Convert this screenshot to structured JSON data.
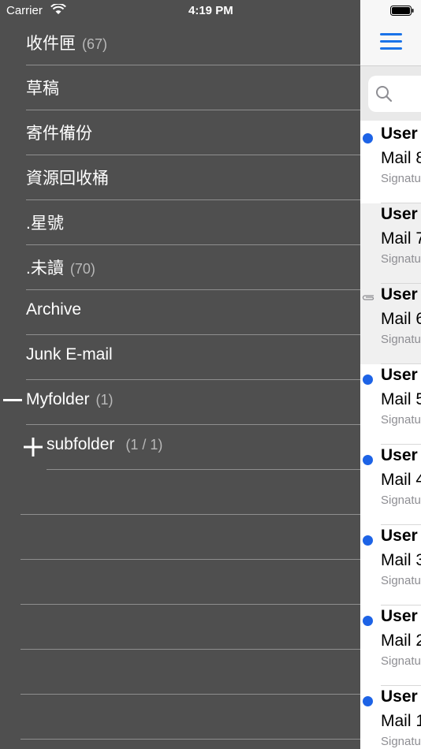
{
  "status_bar": {
    "carrier": "Carrier",
    "time": "4:19 PM"
  },
  "folders": [
    {
      "label": "收件匣",
      "count": "(67)"
    },
    {
      "label": "草稿",
      "count": ""
    },
    {
      "label": "寄件備份",
      "count": ""
    },
    {
      "label": "資源回收桶",
      "count": ""
    },
    {
      "label": ".星號",
      "count": ""
    },
    {
      "label": ".未讀",
      "count": "(70)"
    },
    {
      "label": "Archive",
      "count": ""
    },
    {
      "label": "Junk E-mail",
      "count": ""
    },
    {
      "label": "Myfolder",
      "count": "(1)",
      "toggle": "collapse"
    },
    {
      "label": "subfolder",
      "count": "(1 / 1)",
      "toggle": "expand"
    }
  ],
  "mail_list": [
    {
      "sender": "User",
      "subject": "Mail 8",
      "signature": "Signatu",
      "state": "unread"
    },
    {
      "sender": "User",
      "subject": "Mail 7",
      "signature": "Signatu",
      "state": "read"
    },
    {
      "sender": "User",
      "subject": "Mail 6",
      "signature": "Signatu",
      "state": "attachment"
    },
    {
      "sender": "User",
      "subject": "Mail 5",
      "signature": "Signatu",
      "state": "unread"
    },
    {
      "sender": "User",
      "subject": "Mail 4",
      "signature": "Signatu",
      "state": "unread"
    },
    {
      "sender": "User",
      "subject": "Mail 3",
      "signature": "Signatu",
      "state": "unread"
    },
    {
      "sender": "User",
      "subject": "Mail 2",
      "signature": "Signatu",
      "state": "unread"
    },
    {
      "sender": "User",
      "subject": "Mail 1",
      "signature": "Signatu",
      "state": "unread"
    }
  ],
  "icons": {
    "menu": "hamburger-menu-icon",
    "search": "search-icon",
    "attachment": "paperclip-icon"
  },
  "colors": {
    "sidebar_bg": "#4f4f4f",
    "accent": "#1a73e8",
    "unread_dot": "#1d63e6"
  }
}
